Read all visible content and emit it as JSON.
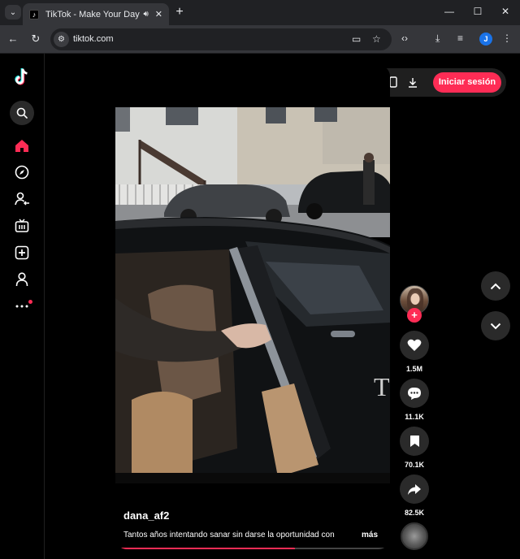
{
  "browser": {
    "tab_title": "TikTok - Make Your Day",
    "url": "tiktok.com",
    "profile_initial": "J",
    "minimize": "—",
    "maximize": "☐",
    "close": "✕",
    "new_tab": "+"
  },
  "header": {
    "login_label": "Iniciar sesión"
  },
  "sidebar": {
    "items": [
      {
        "name": "search",
        "icon": "search-icon"
      },
      {
        "name": "home",
        "icon": "home-icon",
        "active": true
      },
      {
        "name": "explore",
        "icon": "compass-icon"
      },
      {
        "name": "following",
        "icon": "following-icon"
      },
      {
        "name": "live",
        "icon": "live-tv-icon"
      },
      {
        "name": "upload",
        "icon": "plus-square-icon"
      },
      {
        "name": "profile",
        "icon": "profile-icon"
      },
      {
        "name": "more",
        "icon": "more-icon"
      }
    ]
  },
  "video": {
    "username": "dana_af2",
    "caption": "Tantos años intentando sanar sin darse la oportunidad con",
    "more_label": "más",
    "progress": 0.66
  },
  "actions": {
    "likes": "1.5M",
    "comments": "11.1K",
    "saves": "70.1K",
    "shares": "82.5K"
  },
  "colors": {
    "accent": "#fe2c55",
    "background": "#000000",
    "chrome_dark": "#202124",
    "chrome_mid": "#35363a"
  }
}
